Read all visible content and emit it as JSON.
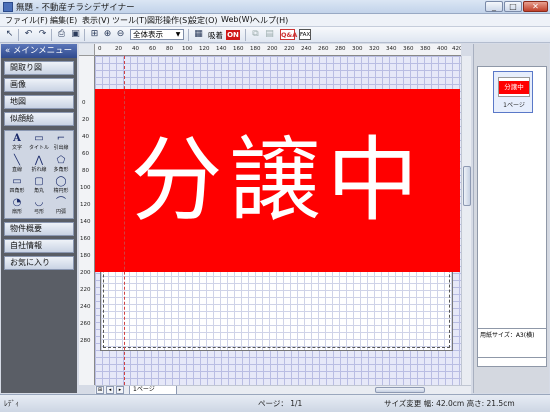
{
  "window": {
    "title": "無題 - 不動産チラシデザイナー",
    "controls": {
      "minimize": "_",
      "maximize": "□",
      "close": "✕"
    }
  },
  "menubar": {
    "items": [
      "ファイル(F)",
      "編集(E)",
      "表示(V)",
      "ツール(T)",
      "図形操作(S)",
      "設定(O)",
      "Web(W)",
      "ヘルプ(H)"
    ]
  },
  "toolbar": {
    "zoom_value": "全体表示",
    "grid_label": "吸着",
    "on_label": "ON",
    "qa_label": "Q&A",
    "fax_label": "FAX"
  },
  "sidebar": {
    "header": "メインメニュー",
    "items": [
      "間取り図",
      "画像",
      "地図",
      "似顔絵"
    ],
    "shapes": [
      {
        "label": "文字",
        "icon": "text-icon"
      },
      {
        "label": "タイトル",
        "icon": "title-icon"
      },
      {
        "label": "引出線",
        "icon": "leader-line-icon"
      },
      {
        "label": "直線",
        "icon": "line-icon"
      },
      {
        "label": "折れ線",
        "icon": "polyline-icon"
      },
      {
        "label": "多角形",
        "icon": "polygon-icon"
      },
      {
        "label": "四角形",
        "icon": "rectangle-icon"
      },
      {
        "label": "角丸",
        "icon": "rounded-rect-icon"
      },
      {
        "label": "楕円形",
        "icon": "ellipse-icon"
      },
      {
        "label": "扇形",
        "icon": "sector-icon"
      },
      {
        "label": "弓形",
        "icon": "arc-icon"
      },
      {
        "label": "円弧",
        "icon": "circular-arc-icon"
      }
    ],
    "bottom_items": [
      "物件概要",
      "自社情報",
      "お気に入り"
    ]
  },
  "ruler": {
    "h_ticks": [
      "0",
      "20",
      "40",
      "60",
      "80",
      "100",
      "120",
      "140",
      "160",
      "180",
      "200",
      "220",
      "240",
      "260",
      "280",
      "300",
      "320",
      "340",
      "360",
      "380",
      "400",
      "420"
    ],
    "v_ticks": [
      "0",
      "20",
      "40",
      "60",
      "80",
      "100",
      "120",
      "140",
      "160",
      "180",
      "200",
      "220",
      "240",
      "260",
      "280"
    ]
  },
  "canvas": {
    "banner_text": "分譲中",
    "banner_color": "#ff0000"
  },
  "page_tabs": {
    "current": "1ページ"
  },
  "right_panel": {
    "thumbnail_text": "分譲中",
    "thumbnail_label": "1ページ",
    "paper_size": "用紙サイズ：A3(横)"
  },
  "statusbar": {
    "mode": "ﾚﾃﾞｨ",
    "page": "ページ： 1/1",
    "size": "サイズ変更 幅: 42.0cm 高さ: 21.5cm"
  }
}
